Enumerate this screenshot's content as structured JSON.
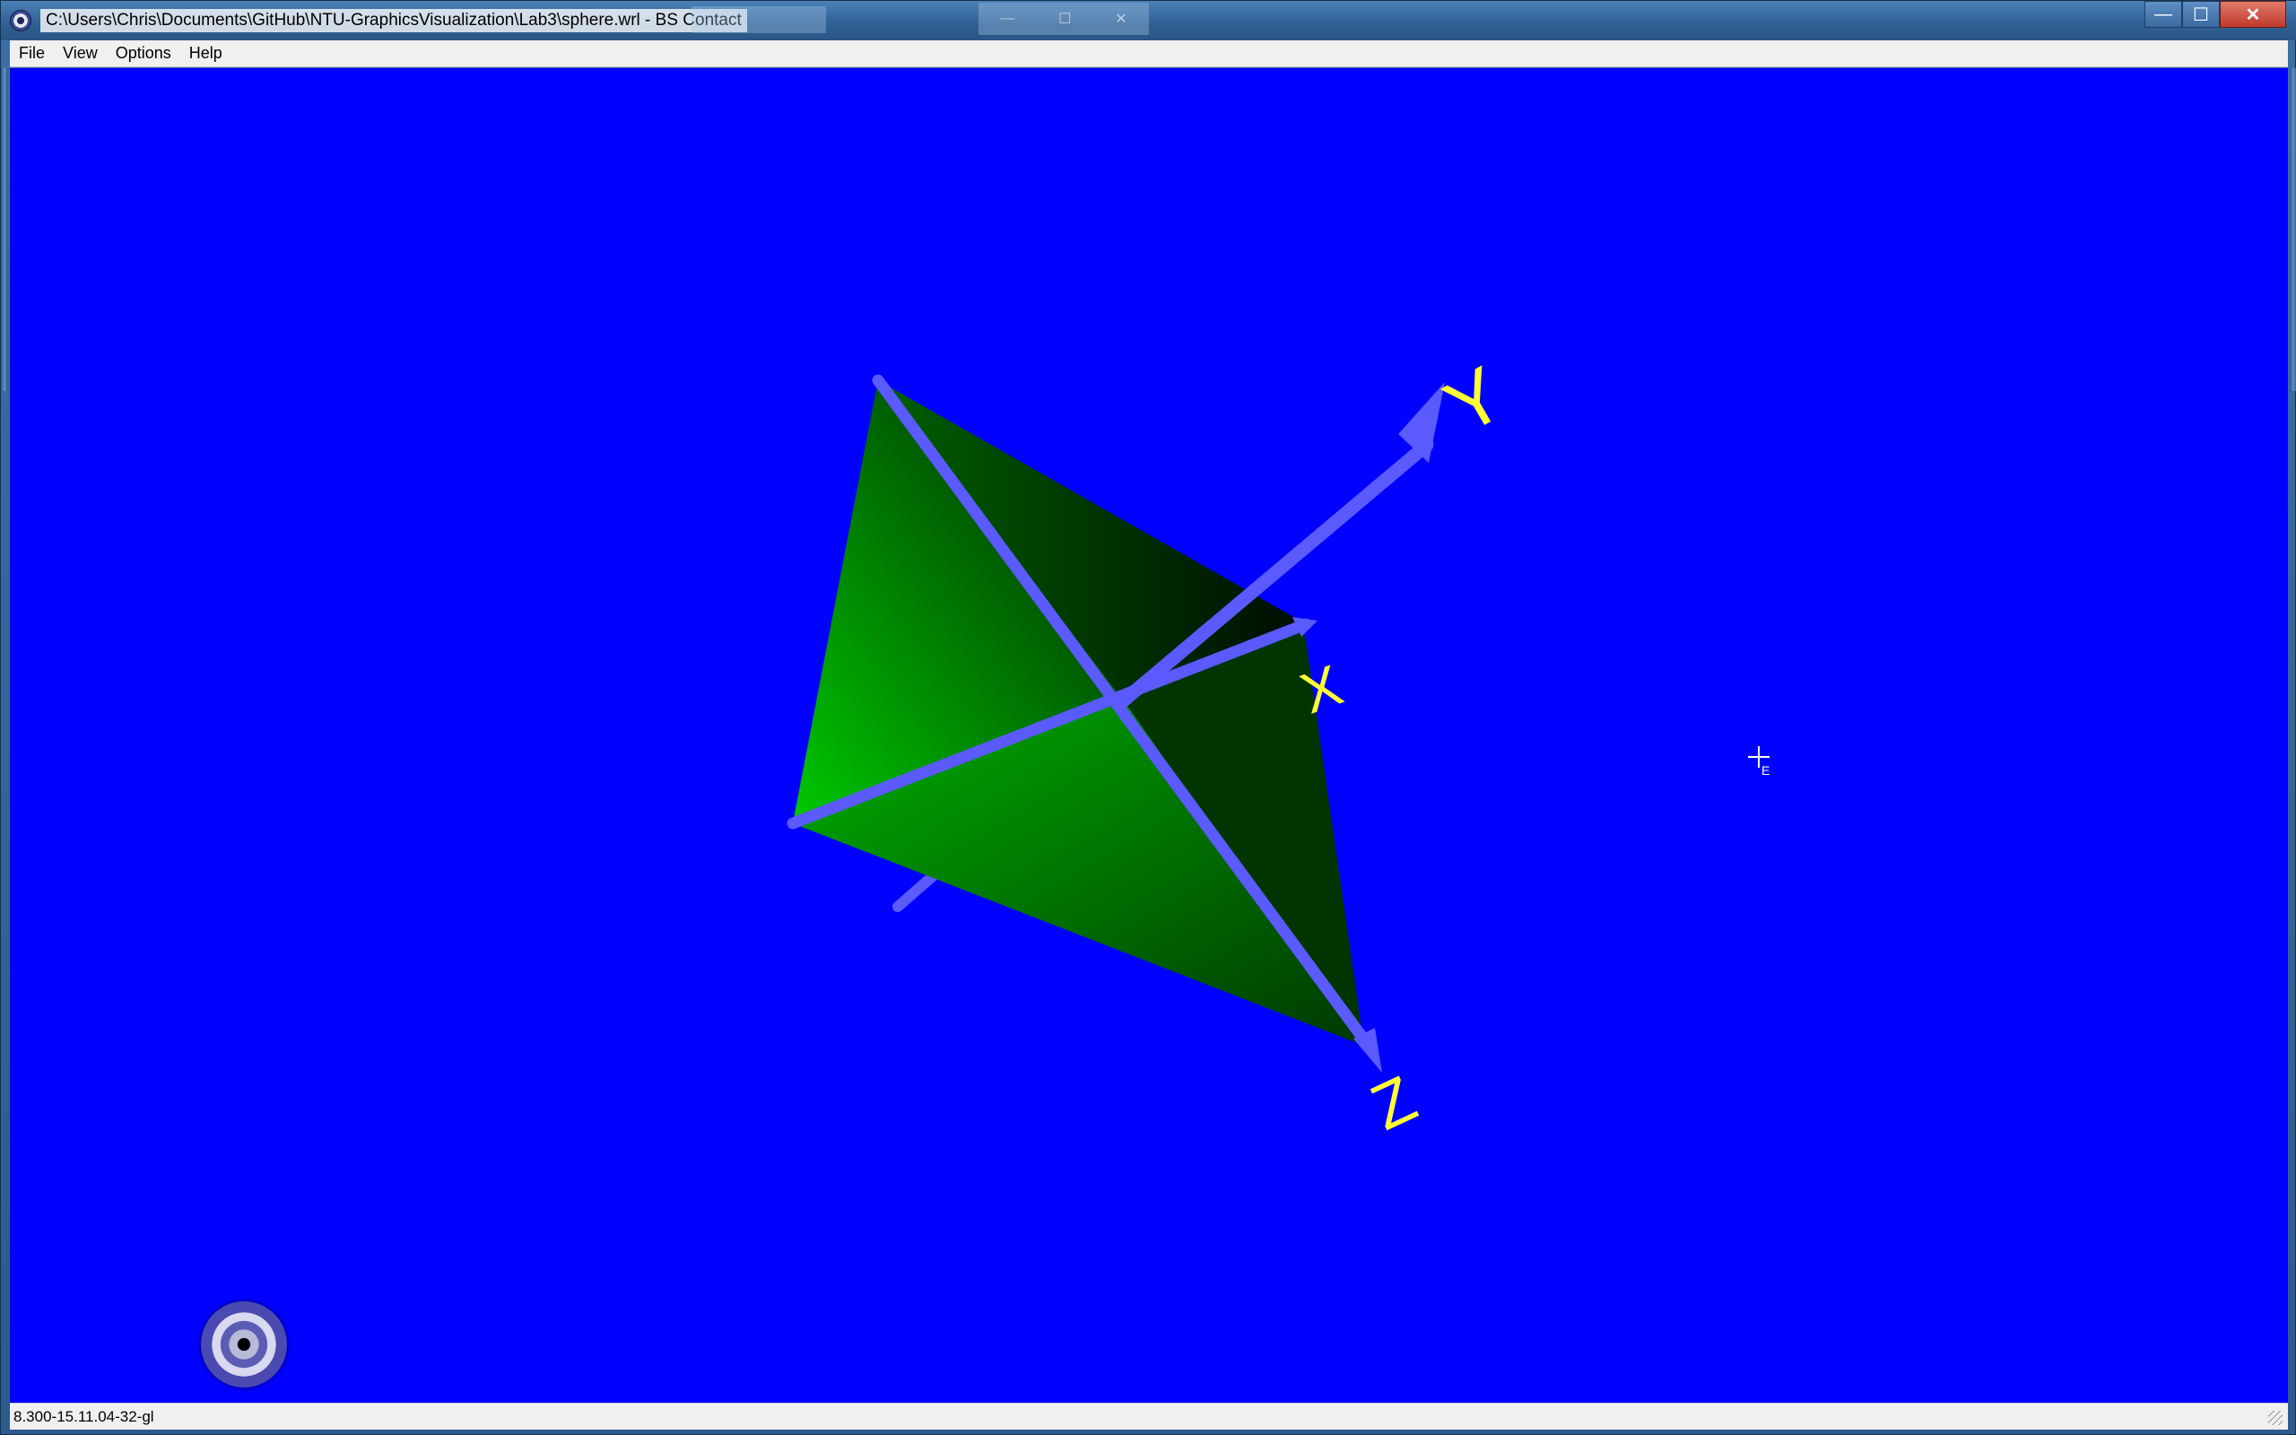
{
  "window": {
    "title": "C:\\Users\\Chris\\Documents\\GitHub\\NTU-GraphicsVisualization\\Lab3\\sphere.wrl - BS Contact",
    "controls": {
      "minimize": "—",
      "maximize": "☐",
      "close": "✕"
    }
  },
  "menu": {
    "items": [
      "File",
      "View",
      "Options",
      "Help"
    ]
  },
  "scene": {
    "background_color": "#0000ff",
    "axis_labels": {
      "x": "X",
      "y": "Y",
      "z": "Z"
    },
    "label_color": "#ffff33",
    "axis_color": "#5a5aff",
    "shape_color_light": "#00cc00",
    "shape_color_dark": "#001800",
    "cursor_label": "E"
  },
  "status": {
    "text": "8.300-15.11.04-32-gl"
  }
}
